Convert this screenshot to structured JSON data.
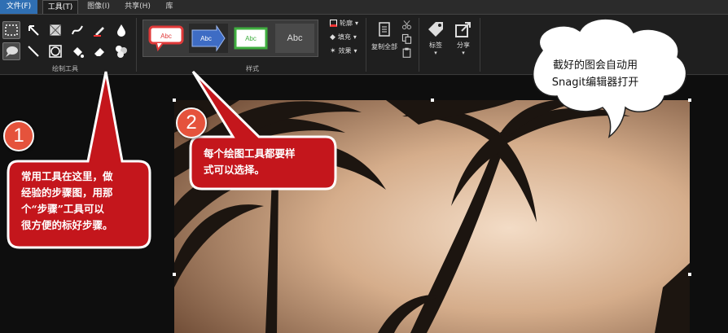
{
  "tabs": [
    {
      "label": "文件(F)"
    },
    {
      "label": "工具(T)"
    },
    {
      "label": "图像(I)"
    },
    {
      "label": "共享(H)"
    },
    {
      "label": "库"
    }
  ],
  "ribbon": {
    "drawing_tools_label": "绘制工具",
    "styles_label": "样式",
    "style_thumbs": [
      {
        "text": "Abc",
        "color": "#e03a3a"
      },
      {
        "text": "Abc",
        "color": "#4a78c8"
      },
      {
        "text": "Abc",
        "color": "#3fae3f"
      },
      {
        "text": "Abc",
        "color": "#dddddd"
      }
    ],
    "outline_label": "轮廓",
    "fill_label": "填充",
    "effects_label": "效果",
    "copy_all_label": "复制全部",
    "tag_label": "标签",
    "share_label": "分享"
  },
  "annotations": {
    "step1_number": "1",
    "step1_text": [
      "常用工具在这里，做",
      "经验的步骤图，用那",
      "个“步骤”工具可以",
      "很方便的标好步骤。"
    ],
    "step2_number": "2",
    "step2_text": [
      "每个绘图工具都要样",
      "式可以选择。"
    ],
    "cloud_text": [
      "截好的图会自动用",
      "Snagit编辑器打开"
    ]
  },
  "colors": {
    "callout_red": "#c4161c",
    "badge": "#e5533c",
    "file_tab": "#2f6fb3"
  }
}
